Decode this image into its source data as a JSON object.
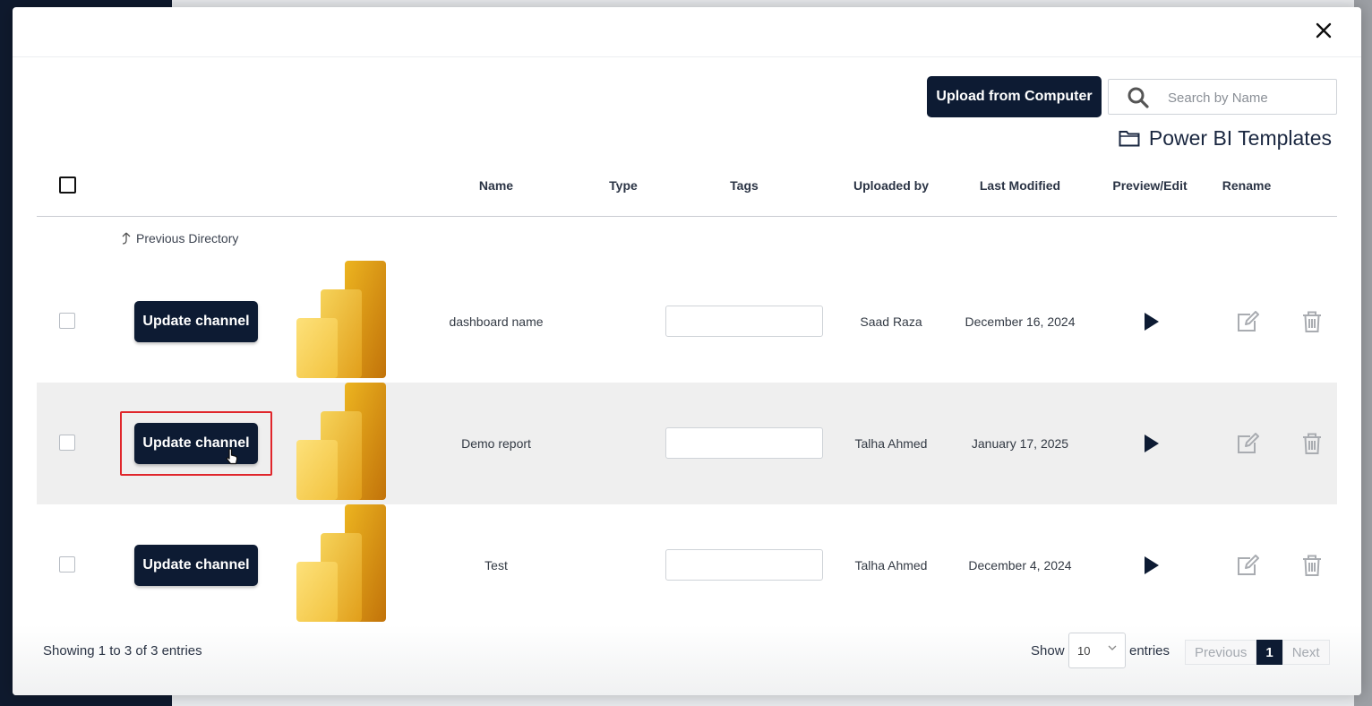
{
  "toolbar": {
    "upload_label": "Upload from Computer",
    "search_placeholder": "Search by Name"
  },
  "folder": {
    "title": "Power BI Templates",
    "icon": "folder-icon"
  },
  "table": {
    "columns": [
      "Name",
      "Type",
      "Tags",
      "Uploaded by",
      "Last Modified",
      "Preview/Edit",
      "Rename"
    ],
    "previous_directory": "Previous Directory",
    "rows": [
      {
        "action_label": "Update channel",
        "name": "dashboard name",
        "type": "",
        "tags": "",
        "uploaded_by": "Saad Raza",
        "last_modified": "December 16, 2024"
      },
      {
        "action_label": "Update channel",
        "name": "Demo report",
        "type": "",
        "tags": "",
        "uploaded_by": "Talha Ahmed",
        "last_modified": "January 17, 2025"
      },
      {
        "action_label": "Update channel",
        "name": "Test",
        "type": "",
        "tags": "",
        "uploaded_by": "Talha Ahmed",
        "last_modified": "December 4, 2024"
      }
    ]
  },
  "footer": {
    "showing": "Showing 1 to 3 of 3 entries",
    "show_label": "Show",
    "page_size": "10",
    "entries_label": "entries",
    "previous": "Previous",
    "current_page": "1",
    "next": "Next"
  },
  "colors": {
    "primary": "#0d1b33",
    "highlight": "#e0262b",
    "row_alt": "#efefef"
  }
}
